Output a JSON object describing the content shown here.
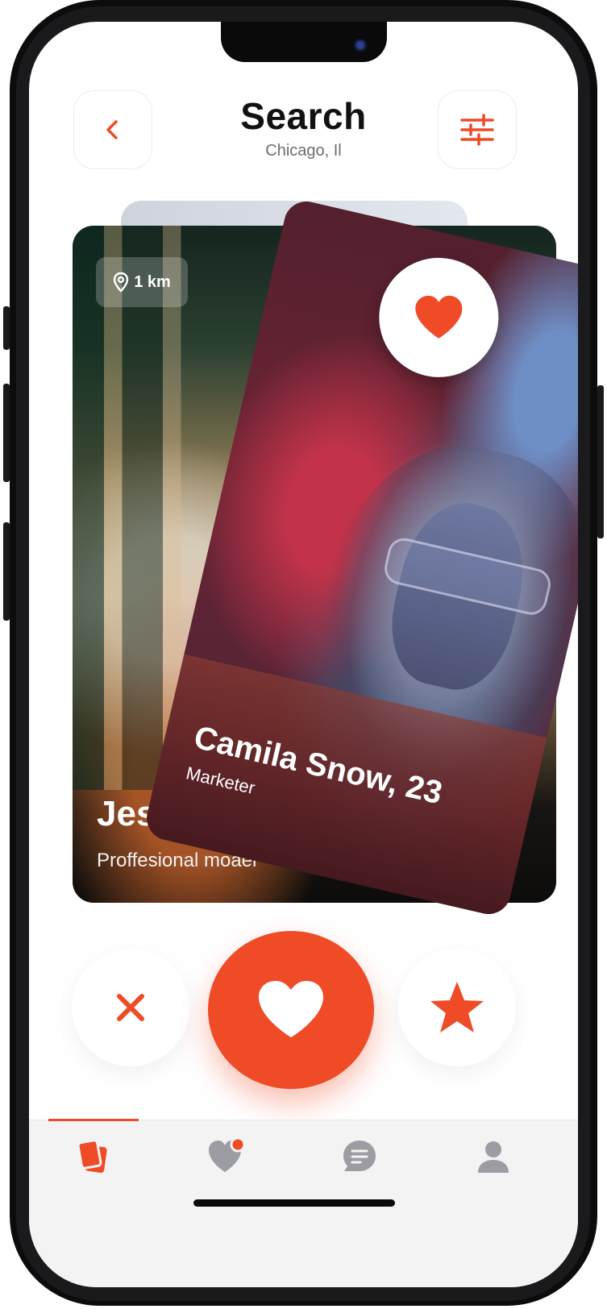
{
  "header": {
    "title": "Search",
    "location": "Chicago, Il"
  },
  "back_card": {
    "distance": "1 km",
    "name": "Jes",
    "occupation": "Proffesional moael"
  },
  "front_card": {
    "name": "Camila Snow, 23",
    "occupation": "Marketer"
  },
  "actions": {
    "dislike_icon": "close-icon",
    "like_icon": "heart-icon",
    "superlike_icon": "star-icon"
  },
  "tabs": [
    {
      "icon": "cards-icon",
      "active": true
    },
    {
      "icon": "heart-notification-icon",
      "active": false,
      "has_badge": true
    },
    {
      "icon": "chat-icon",
      "active": false
    },
    {
      "icon": "profile-icon",
      "active": false
    }
  ],
  "colors": {
    "accent": "#ee4b26",
    "tab_inactive": "#9c9ca3",
    "text_primary": "#111111"
  }
}
